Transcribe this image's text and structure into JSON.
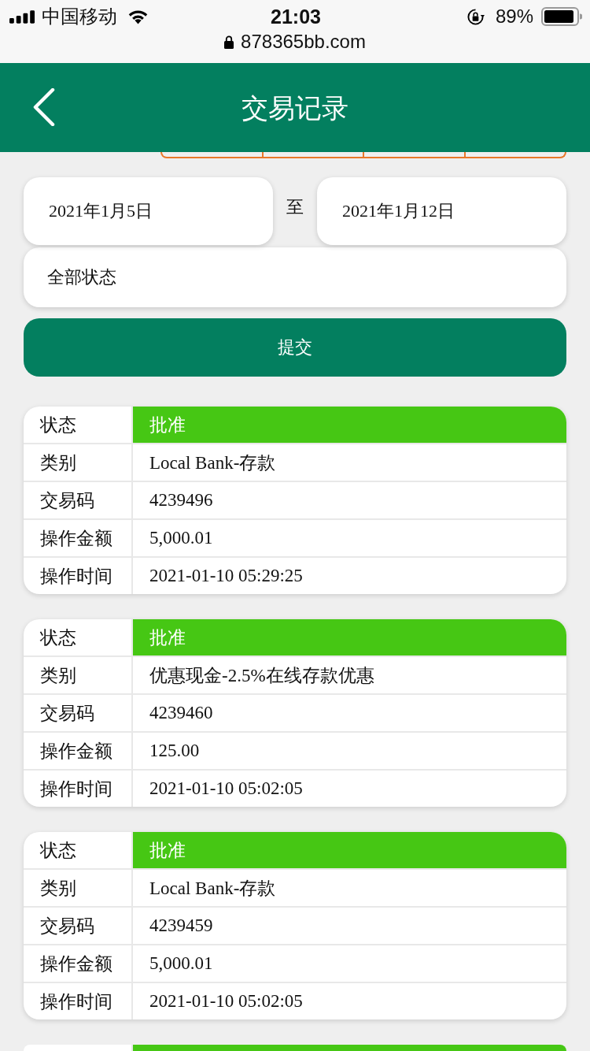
{
  "status_bar": {
    "carrier": "中国移动",
    "time": "21:03",
    "battery": "89%",
    "url": "878365bb.com"
  },
  "header": {
    "title": "交易记录"
  },
  "filter": {
    "start_date": "2021年1月5日",
    "separator": "至",
    "end_date": "2021年1月12日",
    "status": "全部状态",
    "submit": "提交"
  },
  "records": [
    {
      "rows": [
        {
          "kind": "status",
          "label": "状态",
          "value": "批准",
          "color": "#46c714"
        },
        {
          "kind": "field",
          "label": "类别",
          "value": "Local Bank-存款"
        },
        {
          "kind": "field",
          "label": "交易码",
          "value": "4239496"
        },
        {
          "kind": "field",
          "label": "操作金额",
          "value": "5,000.01"
        },
        {
          "kind": "field",
          "label": "操作时间",
          "value": "2021-01-10 05:29:25"
        }
      ]
    },
    {
      "rows": [
        {
          "kind": "status",
          "label": "状态",
          "value": "批准",
          "color": "#46c714"
        },
        {
          "kind": "field",
          "label": "类别",
          "value": "优惠现金-2.5%在线存款优惠"
        },
        {
          "kind": "field",
          "label": "交易码",
          "value": "4239460"
        },
        {
          "kind": "field",
          "label": "操作金额",
          "value": "125.00"
        },
        {
          "kind": "field",
          "label": "操作时间",
          "value": "2021-01-10 05:02:05"
        }
      ]
    },
    {
      "rows": [
        {
          "kind": "status",
          "label": "状态",
          "value": "批准",
          "color": "#46c714"
        },
        {
          "kind": "field",
          "label": "类别",
          "value": "Local Bank-存款"
        },
        {
          "kind": "field",
          "label": "交易码",
          "value": "4239459"
        },
        {
          "kind": "field",
          "label": "操作金额",
          "value": "5,000.01"
        },
        {
          "kind": "field",
          "label": "操作时间",
          "value": "2021-01-10 05:02:05"
        }
      ]
    }
  ]
}
